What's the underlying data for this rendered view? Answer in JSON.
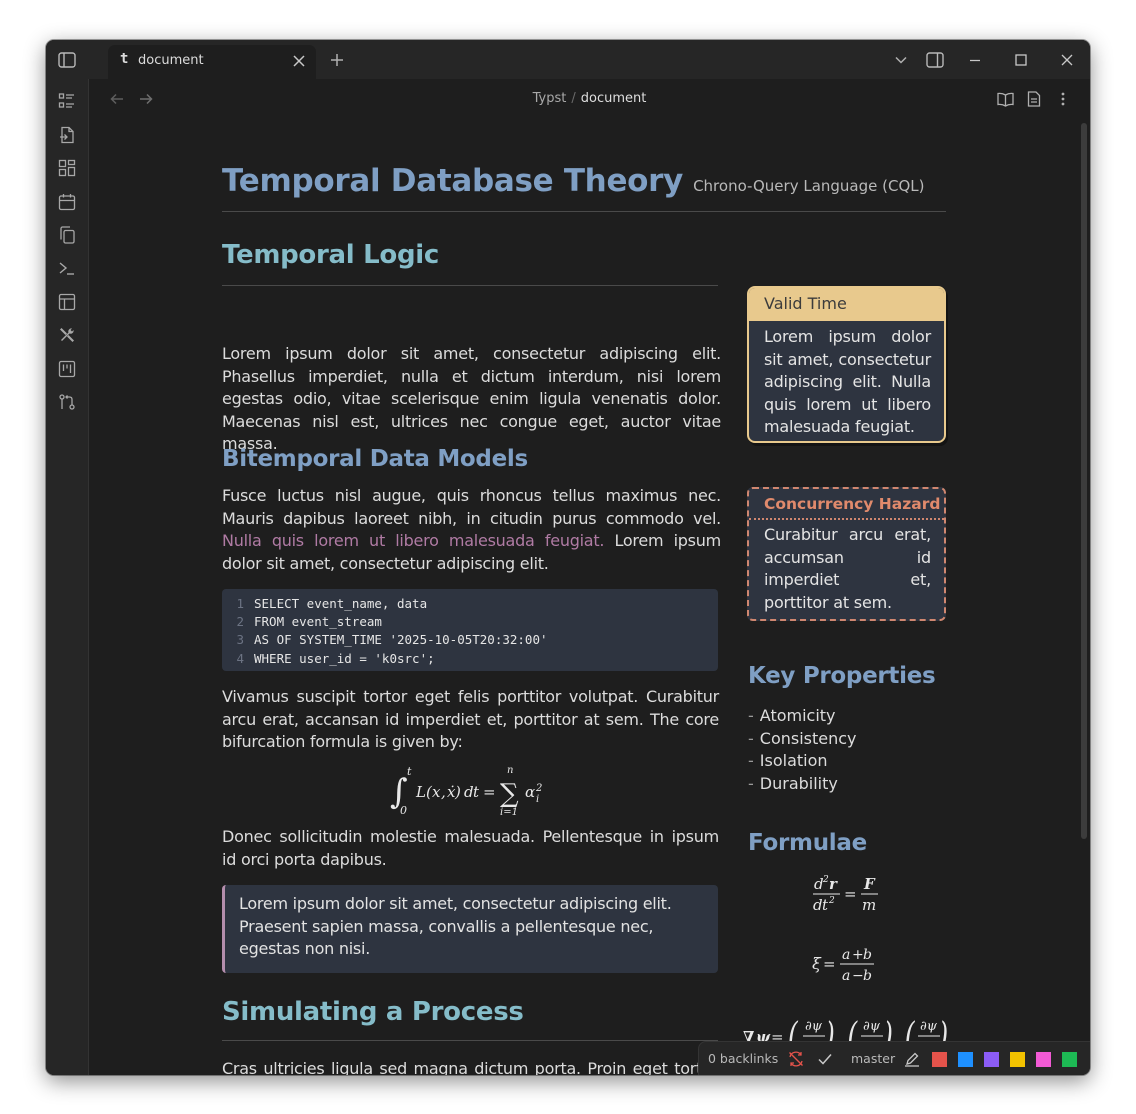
{
  "tab": {
    "icon_glyph": "t",
    "title": "document"
  },
  "breadcrumb": {
    "folder": "Typst",
    "separator": "/",
    "file": "document"
  },
  "doc": {
    "title": "Temporal Database Theory",
    "subtitle": "Chrono-Query Language (CQL)",
    "section1": "Temporal Logic",
    "para1": "Lorem ipsum dolor sit amet, consectetur adipiscing elit. Phasellus imperdiet, nulla et dictum interdum, nisi lorem egestas odio, vitae scelerisque enim ligula venenatis dolor. Maecenas nisl est, ultrices nec congue eget, auctor vitae massa.",
    "section2": "Bitemporal Data Models",
    "para2_a": "Fusce luctus nisl augue, quis rhoncus tellus maximus nec. Mauris dapibus laoreet nibh, in citudin purus commodo vel. ",
    "para2_link": "Nulla quis lorem ut libero malesuada feugiat.",
    "para2_b": " Lorem ipsum dolor sit amet, consectetur adipiscing elit.",
    "code": [
      {
        "n": "1",
        "text": "SELECT event_name, data"
      },
      {
        "n": "2",
        "text": "FROM event_stream"
      },
      {
        "n": "3",
        "text": "AS OF SYSTEM_TIME '2025-10-05T20:32:00'"
      },
      {
        "n": "4",
        "text": "WHERE user_id = 'k0src';"
      }
    ],
    "para3": "Vivamus suscipit tortor eget felis porttitor volutpat. Curabitur arcu erat, accansan id imperdiet et, porttitor at sem. The core bifurcation formula is given by:",
    "para4": "Donec sollicitudin molestie malesuada. Pellentesque in ipsum id orci porta dapibus.",
    "quote": "Lorem ipsum dolor sit amet, consectetur adipiscing elit. Praesent sapien massa, convallis a pellentesque nec, egestas non nisi.",
    "section3": "Simulating a Process",
    "para5": "Cras ultricies ligula sed magna dictum porta. Proin eget tortor risus. Vestibulum ac diam sit amet quam vehicula elementum sed sit amet dui."
  },
  "sidebar": {
    "valid_title": "Valid Time",
    "valid_body": "Lorem ipsum dolor sit amet, consectetur adipiscing elit. Nulla quis lorem ut libero malesuada feugiat.",
    "hazard_title": "Concurrency Hazard",
    "hazard_body": "Curabitur arcu erat, accumsan id imperdiet et, porttitor at sem.",
    "key_heading": "Key Properties",
    "key_items": [
      "Atomicity",
      "Consistency",
      "Isolation",
      "Durability"
    ],
    "formulae_heading": "Formulae"
  },
  "status": {
    "backlinks": "0 backlinks",
    "branch": "master",
    "swatches": [
      "#e5534b",
      "#1e90ff",
      "#8b5cf6",
      "#f2c200",
      "#f25ad5",
      "#1db954"
    ]
  },
  "colors": {
    "accent_heading": "#85bcc9",
    "title_blue": "#7f9fc4",
    "link": "#b07ba4",
    "valid": "#e8c98d",
    "hazard": "#d08770"
  }
}
